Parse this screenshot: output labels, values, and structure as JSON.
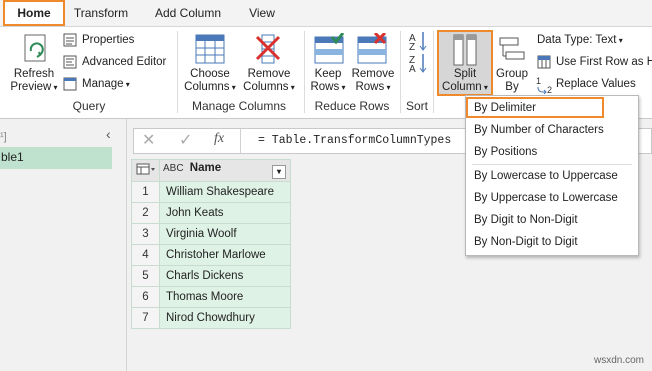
{
  "tabs": [
    "Home",
    "Transform",
    "Add Column",
    "View"
  ],
  "ribbon": {
    "query": {
      "refresh_preview": "Refresh\nPreview",
      "properties": "Properties",
      "advanced_editor": "Advanced Editor",
      "manage": "Manage",
      "label": "Query"
    },
    "manage_columns": {
      "choose_columns": "Choose\nColumns",
      "remove_columns": "Remove\nColumns",
      "label": "Manage Columns"
    },
    "reduce_rows": {
      "keep_rows": "Keep\nRows",
      "remove_rows": "Remove\nRows",
      "label": "Reduce Rows"
    },
    "sort": {
      "label": "Sort"
    },
    "split_column": "Split\nColumn",
    "group_by": "Group\nBy",
    "data_type": "Data Type: Text",
    "first_row_header": "Use First Row as H",
    "replace_values": "Replace Values"
  },
  "split_menu": {
    "items_group1": [
      "By Delimiter",
      "By Number of Characters",
      "By Positions"
    ],
    "items_group2": [
      "By Lowercase to Uppercase",
      "By Uppercase to Lowercase",
      "By Digit to Non-Digit",
      "By Non-Digit to Digit"
    ]
  },
  "nav": {
    "header_fragment": "¹]",
    "query_name": "ble1"
  },
  "formula": {
    "fx": "fx",
    "text": "= Table.TransformColumnTypes"
  },
  "table": {
    "type_icon": "ABC",
    "column": "Name",
    "rows": [
      {
        "n": "1",
        "name": "William Shakespeare"
      },
      {
        "n": "2",
        "name": "John Keats"
      },
      {
        "n": "3",
        "name": "Virginia Woolf"
      },
      {
        "n": "4",
        "name": "Christoher Marlowe"
      },
      {
        "n": "5",
        "name": "Charls Dickens"
      },
      {
        "n": "6",
        "name": "Thomas Moore"
      },
      {
        "n": "7",
        "name": "Nirod Chowdhury"
      }
    ]
  },
  "watermark": "wsxdn.com",
  "colors": {
    "highlight": "#ef8a2c",
    "query_selected": "#bfe2cf",
    "cell": "#dff2e6"
  }
}
